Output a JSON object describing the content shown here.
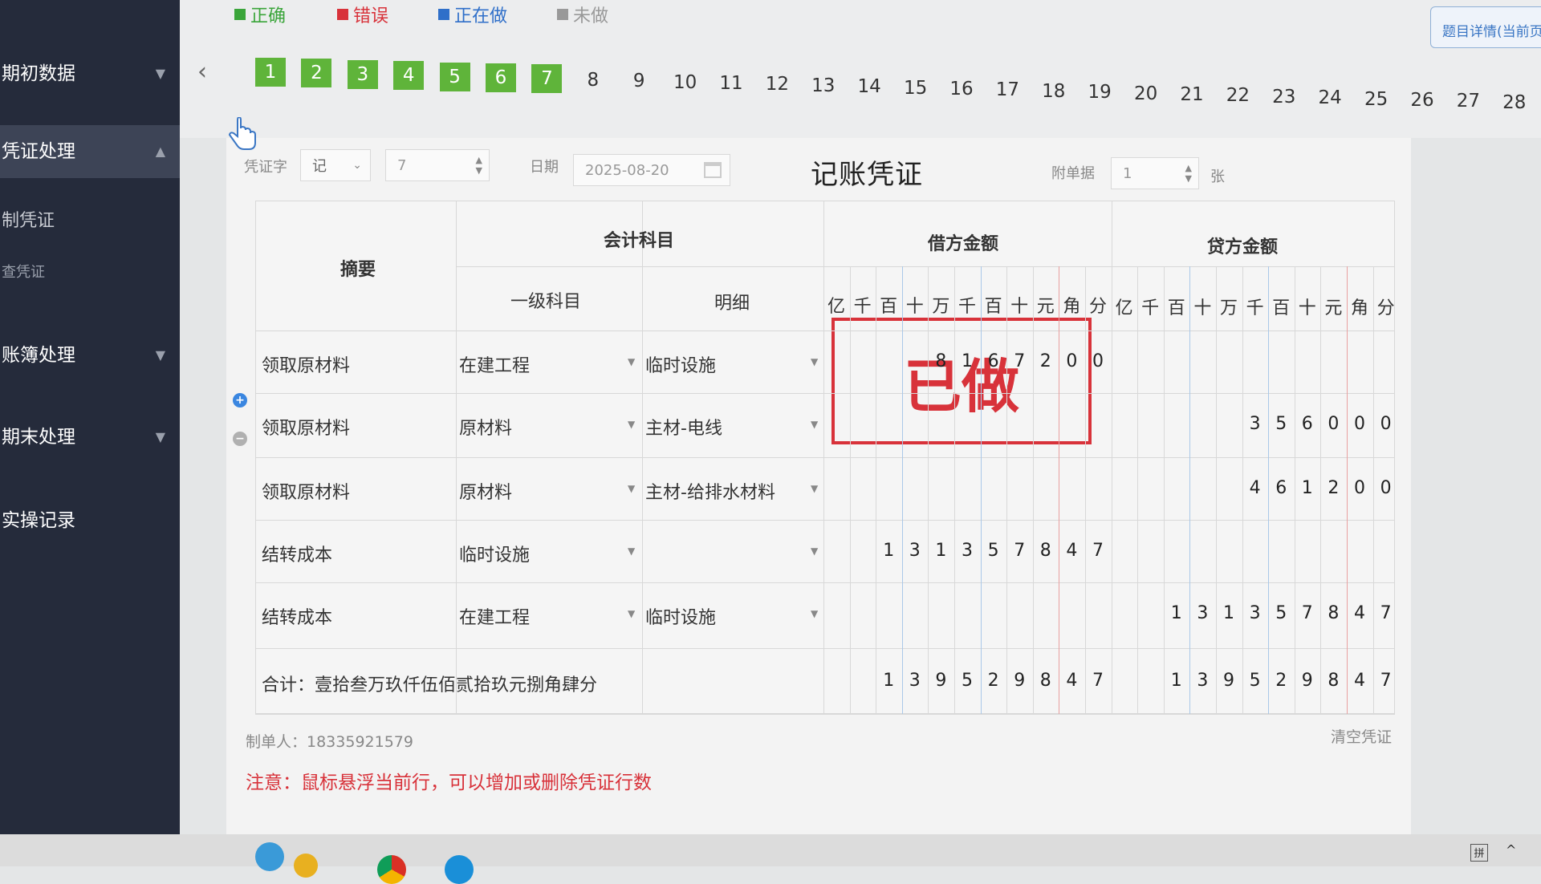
{
  "sidebar": {
    "items": [
      {
        "label": "期初数据",
        "arrow": "▼"
      },
      {
        "label": "凭证处理",
        "arrow": "▲"
      },
      {
        "label": "制凭证"
      },
      {
        "label": "查凭证"
      },
      {
        "label": "账簿处理",
        "arrow": "▼"
      },
      {
        "label": "期末处理",
        "arrow": "▼"
      },
      {
        "label": "实操记录"
      }
    ]
  },
  "legend": [
    {
      "label": "正确",
      "color": "#3aa53a"
    },
    {
      "label": "错误",
      "color": "#d8323a"
    },
    {
      "label": "正在做",
      "color": "#2f6fc9"
    },
    {
      "label": "未做",
      "color": "#999999"
    }
  ],
  "detail_button": "题目详情(当前页)",
  "questions": {
    "done": [
      "1",
      "2",
      "3",
      "4",
      "5",
      "6",
      "7"
    ],
    "todo": [
      "8",
      "9",
      "10",
      "11",
      "12",
      "13",
      "14",
      "15",
      "16",
      "17",
      "18",
      "19",
      "20",
      "21",
      "22",
      "23",
      "24",
      "25",
      "26",
      "27",
      "28"
    ]
  },
  "voucher": {
    "title": "记账凭证",
    "word_label": "凭证字",
    "word_value": "记",
    "number_value": "7",
    "date_label": "日期",
    "date_value": "2025-08-20",
    "attach_label": "附单据",
    "attach_value": "1",
    "attach_unit": "张"
  },
  "table": {
    "summary_header": "摘要",
    "account_header": "会计科目",
    "level1_header": "一级科目",
    "detail_header": "明细",
    "debit_header": "借方金额",
    "credit_header": "贷方金额",
    "units": [
      "亿",
      "千",
      "百",
      "十",
      "万",
      "千",
      "百",
      "十",
      "元",
      "角",
      "分"
    ],
    "rows": [
      {
        "summary": "领取原材料",
        "level1": "在建工程",
        "detail": "临时设施",
        "debit": "8167200",
        "credit": ""
      },
      {
        "summary": "领取原材料",
        "level1": "原材料",
        "detail": "主材-电线",
        "debit": "",
        "credit": "356000"
      },
      {
        "summary": "领取原材料",
        "level1": "原材料",
        "detail": "主材-给排水材料",
        "debit": "",
        "credit": "461200"
      },
      {
        "summary": "结转成本",
        "level1": "临时设施",
        "detail": "",
        "debit": "131357847",
        "credit": ""
      },
      {
        "summary": "结转成本",
        "level1": "在建工程",
        "detail": "临时设施",
        "debit": "",
        "credit": "131357847"
      }
    ],
    "total_label": "合计：壹拾叁万玖仟伍佰贰拾玖元捌角肆分",
    "total_debit": "139529847",
    "total_credit": "139529847"
  },
  "stamp": "已做",
  "maker": "制单人：18335921579",
  "clear_button": "清空凭证",
  "note": "注意：鼠标悬浮当前行，可以增加或删除凭证行数"
}
